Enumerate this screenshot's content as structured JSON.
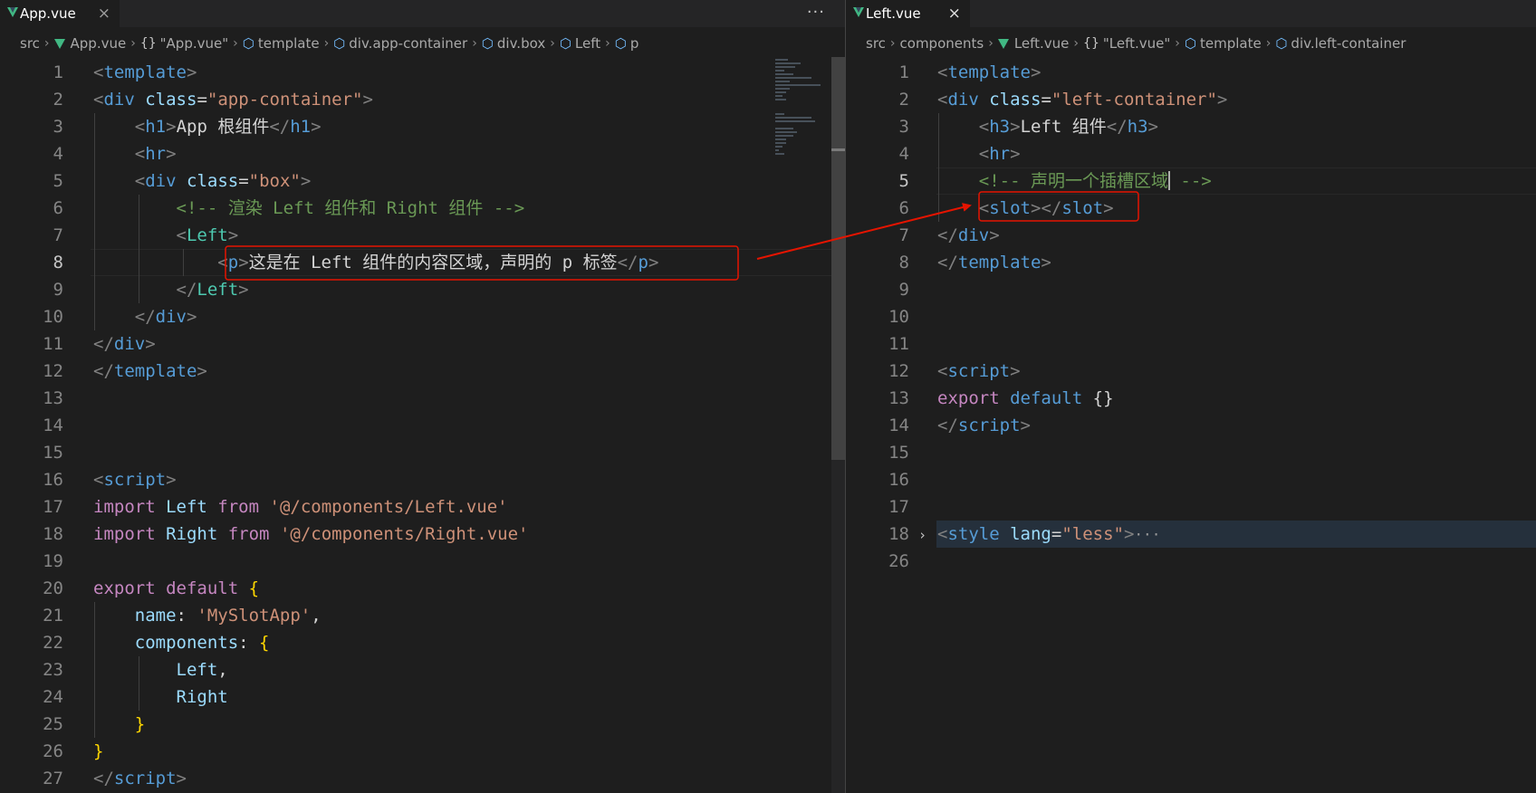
{
  "left_pane": {
    "tab": {
      "label": "App.vue",
      "close": "×"
    },
    "more_actions": "···",
    "breadcrumb": [
      {
        "label": "src",
        "icon": "none"
      },
      {
        "label": "App.vue",
        "icon": "vue-icon"
      },
      {
        "label": "\"App.vue\"",
        "icon": "braces-icon"
      },
      {
        "label": "template",
        "icon": "box-icon"
      },
      {
        "label": "div.app-container",
        "icon": "box-icon"
      },
      {
        "label": "div.box",
        "icon": "box-icon"
      },
      {
        "label": "Left",
        "icon": "box-icon"
      },
      {
        "label": "p",
        "icon": "box-icon"
      }
    ],
    "lines": [
      {
        "n": "1",
        "c": [
          [
            "<",
            "tag"
          ],
          [
            "template",
            "el"
          ],
          [
            ">",
            "tag"
          ]
        ]
      },
      {
        "n": "2",
        "c": [
          [
            "<",
            "tag"
          ],
          [
            "div",
            "el"
          ],
          [
            " ",
            "txt"
          ],
          [
            "class",
            "attr"
          ],
          [
            "=",
            "txt"
          ],
          [
            "\"app-container\"",
            "str"
          ],
          [
            ">",
            "tag"
          ]
        ]
      },
      {
        "n": "3",
        "c": [
          [
            "    ",
            "txt"
          ],
          [
            "<",
            "tag"
          ],
          [
            "h1",
            "el"
          ],
          [
            ">",
            "tag"
          ],
          [
            "App 根组件",
            "txt"
          ],
          [
            "</",
            "tag"
          ],
          [
            "h1",
            "el"
          ],
          [
            ">",
            "tag"
          ]
        ]
      },
      {
        "n": "4",
        "c": [
          [
            "    ",
            "txt"
          ],
          [
            "<",
            "tag"
          ],
          [
            "hr",
            "el"
          ],
          [
            ">",
            "tag"
          ]
        ]
      },
      {
        "n": "5",
        "c": [
          [
            "    ",
            "txt"
          ],
          [
            "<",
            "tag"
          ],
          [
            "div",
            "el"
          ],
          [
            " ",
            "txt"
          ],
          [
            "class",
            "attr"
          ],
          [
            "=",
            "txt"
          ],
          [
            "\"box\"",
            "str"
          ],
          [
            ">",
            "tag"
          ]
        ]
      },
      {
        "n": "6",
        "c": [
          [
            "        ",
            "txt"
          ],
          [
            "<!-- 渲染 Left 组件和 Right 组件 -->",
            "com"
          ]
        ]
      },
      {
        "n": "7",
        "c": [
          [
            "        ",
            "txt"
          ],
          [
            "<",
            "tag"
          ],
          [
            "Left",
            "comp"
          ],
          [
            ">",
            "tag"
          ]
        ]
      },
      {
        "n": "8",
        "c": [
          [
            "            ",
            "txt"
          ],
          [
            "<",
            "tag"
          ],
          [
            "p",
            "el"
          ],
          [
            ">",
            "tag"
          ],
          [
            "这是在 Left 组件的内容区域，声明的 p 标签",
            "txt"
          ],
          [
            "</",
            "tag"
          ],
          [
            "p",
            "el"
          ],
          [
            ">",
            "tag"
          ]
        ]
      },
      {
        "n": "9",
        "c": [
          [
            "        ",
            "txt"
          ],
          [
            "</",
            "tag"
          ],
          [
            "Left",
            "comp"
          ],
          [
            ">",
            "tag"
          ]
        ]
      },
      {
        "n": "10",
        "c": [
          [
            "    ",
            "txt"
          ],
          [
            "</",
            "tag"
          ],
          [
            "div",
            "el"
          ],
          [
            ">",
            "tag"
          ]
        ]
      },
      {
        "n": "11",
        "c": [
          [
            "</",
            "tag"
          ],
          [
            "div",
            "el"
          ],
          [
            ">",
            "tag"
          ]
        ]
      },
      {
        "n": "12",
        "c": [
          [
            "</",
            "tag"
          ],
          [
            "template",
            "el"
          ],
          [
            ">",
            "tag"
          ]
        ]
      },
      {
        "n": "13",
        "c": []
      },
      {
        "n": "14",
        "c": []
      },
      {
        "n": "15",
        "c": []
      },
      {
        "n": "16",
        "c": [
          [
            "<",
            "tag"
          ],
          [
            "script",
            "el"
          ],
          [
            ">",
            "tag"
          ]
        ]
      },
      {
        "n": "17",
        "c": [
          [
            "import",
            "kw"
          ],
          [
            " Left ",
            "var"
          ],
          [
            "from",
            "kw"
          ],
          [
            " ",
            "txt"
          ],
          [
            "'@/components/Left.vue'",
            "str"
          ]
        ]
      },
      {
        "n": "18",
        "c": [
          [
            "import",
            "kw"
          ],
          [
            " Right ",
            "var"
          ],
          [
            "from",
            "kw"
          ],
          [
            " ",
            "txt"
          ],
          [
            "'@/components/Right.vue'",
            "str"
          ]
        ]
      },
      {
        "n": "19",
        "c": []
      },
      {
        "n": "20",
        "c": [
          [
            "export",
            "kw"
          ],
          [
            " ",
            "txt"
          ],
          [
            "default",
            "kw"
          ],
          [
            " ",
            "txt"
          ],
          [
            "{",
            "br"
          ]
        ]
      },
      {
        "n": "21",
        "c": [
          [
            "    ",
            "txt"
          ],
          [
            "name",
            "var"
          ],
          [
            ": ",
            "txt"
          ],
          [
            "'MySlotApp'",
            "str"
          ],
          [
            ",",
            "txt"
          ]
        ]
      },
      {
        "n": "22",
        "c": [
          [
            "    ",
            "txt"
          ],
          [
            "components",
            "var"
          ],
          [
            ": ",
            "txt"
          ],
          [
            "{",
            "br"
          ]
        ]
      },
      {
        "n": "23",
        "c": [
          [
            "        ",
            "txt"
          ],
          [
            "Left",
            "var"
          ],
          [
            ",",
            "txt"
          ]
        ]
      },
      {
        "n": "24",
        "c": [
          [
            "        ",
            "txt"
          ],
          [
            "Right",
            "var"
          ]
        ]
      },
      {
        "n": "25",
        "c": [
          [
            "    ",
            "txt"
          ],
          [
            "}",
            "br"
          ]
        ]
      },
      {
        "n": "26",
        "c": [
          [
            "}",
            "br"
          ]
        ]
      },
      {
        "n": "27",
        "c": [
          [
            "</",
            "tag"
          ],
          [
            "script",
            "el"
          ],
          [
            ">",
            "tag"
          ]
        ]
      }
    ]
  },
  "right_pane": {
    "tab": {
      "label": "Left.vue",
      "close": "×"
    },
    "breadcrumb": [
      {
        "label": "src",
        "icon": "none"
      },
      {
        "label": "components",
        "icon": "none"
      },
      {
        "label": "Left.vue",
        "icon": "vue-icon"
      },
      {
        "label": "\"Left.vue\"",
        "icon": "braces-icon"
      },
      {
        "label": "template",
        "icon": "box-icon"
      },
      {
        "label": "div.left-container",
        "icon": "box-icon"
      }
    ],
    "lines": [
      {
        "n": "1",
        "c": [
          [
            "<",
            "tag"
          ],
          [
            "template",
            "el"
          ],
          [
            ">",
            "tag"
          ]
        ]
      },
      {
        "n": "2",
        "c": [
          [
            "<",
            "tag"
          ],
          [
            "div",
            "el"
          ],
          [
            " ",
            "txt"
          ],
          [
            "class",
            "attr"
          ],
          [
            "=",
            "txt"
          ],
          [
            "\"left-container\"",
            "str"
          ],
          [
            ">",
            "tag"
          ]
        ]
      },
      {
        "n": "3",
        "c": [
          [
            "    ",
            "txt"
          ],
          [
            "<",
            "tag"
          ],
          [
            "h3",
            "el"
          ],
          [
            ">",
            "tag"
          ],
          [
            "Left 组件",
            "txt"
          ],
          [
            "</",
            "tag"
          ],
          [
            "h3",
            "el"
          ],
          [
            ">",
            "tag"
          ]
        ]
      },
      {
        "n": "4",
        "c": [
          [
            "    ",
            "txt"
          ],
          [
            "<",
            "tag"
          ],
          [
            "hr",
            "el"
          ],
          [
            ">",
            "tag"
          ]
        ]
      },
      {
        "n": "5",
        "c": [
          [
            "    ",
            "txt"
          ],
          [
            "<!-- 声明一个插槽区域",
            "com"
          ],
          [
            "|",
            "cursor"
          ],
          [
            " -->",
            "com"
          ]
        ]
      },
      {
        "n": "6",
        "c": [
          [
            "    ",
            "txt"
          ],
          [
            "<",
            "tag"
          ],
          [
            "slot",
            "el"
          ],
          [
            ">",
            "tag"
          ],
          [
            "</",
            "tag"
          ],
          [
            "slot",
            "el"
          ],
          [
            ">",
            "tag"
          ]
        ]
      },
      {
        "n": "7",
        "c": [
          [
            "</",
            "tag"
          ],
          [
            "div",
            "el"
          ],
          [
            ">",
            "tag"
          ]
        ]
      },
      {
        "n": "8",
        "c": [
          [
            "</",
            "tag"
          ],
          [
            "template",
            "el"
          ],
          [
            ">",
            "tag"
          ]
        ]
      },
      {
        "n": "9",
        "c": []
      },
      {
        "n": "10",
        "c": []
      },
      {
        "n": "11",
        "c": []
      },
      {
        "n": "12",
        "c": [
          [
            "<",
            "tag"
          ],
          [
            "script",
            "el"
          ],
          [
            ">",
            "tag"
          ]
        ]
      },
      {
        "n": "13",
        "c": [
          [
            "export",
            "kw"
          ],
          [
            " ",
            "txt"
          ],
          [
            "default",
            "kwb"
          ],
          [
            " ",
            "txt"
          ],
          [
            "{}",
            "txt"
          ]
        ]
      },
      {
        "n": "14",
        "c": [
          [
            "</",
            "tag"
          ],
          [
            "script",
            "el"
          ],
          [
            ">",
            "tag"
          ]
        ]
      },
      {
        "n": "15",
        "c": []
      },
      {
        "n": "16",
        "c": []
      },
      {
        "n": "17",
        "c": []
      },
      {
        "n": "18",
        "c": [
          [
            "<",
            "tag"
          ],
          [
            "style",
            "el"
          ],
          [
            " ",
            "txt"
          ],
          [
            "lang",
            "attr"
          ],
          [
            "=",
            "txt"
          ],
          [
            "\"less\"",
            "str"
          ],
          [
            ">",
            "tag"
          ],
          [
            "···",
            "dots"
          ]
        ]
      },
      {
        "n": "26",
        "c": []
      }
    ]
  },
  "colors": {
    "highlight_box": "#e51400",
    "annotation_arrow": "#e51400",
    "vue_green": "#41b883"
  }
}
